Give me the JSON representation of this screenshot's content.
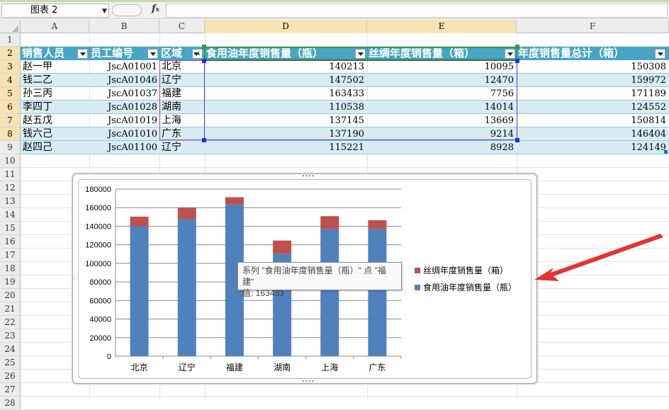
{
  "formula_bar": {
    "name_box": "图表 2",
    "formula": ""
  },
  "columns": [
    "A",
    "B",
    "C",
    "D",
    "E",
    "F"
  ],
  "rows": [
    "1",
    "2",
    "3",
    "4",
    "5",
    "6",
    "7",
    "8",
    "9",
    "10",
    "11",
    "12",
    "13",
    "14",
    "15",
    "16",
    "17",
    "18",
    "19",
    "20",
    "21",
    "22",
    "23",
    "24",
    "25",
    "26",
    "27",
    "28"
  ],
  "table": {
    "headers": [
      "销售人员",
      "员工编号",
      "区域",
      "食用油年度销售量（瓶）",
      "丝绸年度销售量（箱）",
      "年度销售量总计（箱）"
    ],
    "data_rows": [
      {
        "name": "赵一甲",
        "id": "JscA01001",
        "region": "北京",
        "oil": "140213",
        "silk": "10095",
        "total": "150308"
      },
      {
        "name": "钱二乙",
        "id": "JscA01046",
        "region": "辽宁",
        "oil": "147502",
        "silk": "12470",
        "total": "159972"
      },
      {
        "name": "孙三丙",
        "id": "JscA01037",
        "region": "福建",
        "oil": "163433",
        "silk": "7756",
        "total": "171189"
      },
      {
        "name": "李四丁",
        "id": "JscA01028",
        "region": "湖南",
        "oil": "110538",
        "silk": "14014",
        "total": "124552"
      },
      {
        "name": "赵五戊",
        "id": "JscA01019",
        "region": "上海",
        "oil": "137145",
        "silk": "13669",
        "total": "150814"
      },
      {
        "name": "钱六己",
        "id": "JscA01010",
        "region": "广东",
        "oil": "137190",
        "silk": "9214",
        "total": "146404"
      },
      {
        "name": "赵四己",
        "id": "JscA01100",
        "region": "辽宁",
        "oil": "115221",
        "silk": "8928",
        "total": "124149"
      }
    ]
  },
  "colors": {
    "header_fill": "#48a5c5",
    "band_fill": "#d8ecf3",
    "series_oil": "#4f81bd",
    "series_silk": "#c0504d",
    "arrow": "#e53333"
  },
  "chart_data": {
    "type": "bar",
    "stacked": true,
    "categories": [
      "北京",
      "辽宁",
      "福建",
      "湖南",
      "上海",
      "广东"
    ],
    "series": [
      {
        "name": "食用油年度销售量（瓶）",
        "values": [
          140213,
          147502,
          163433,
          110538,
          137145,
          137190
        ]
      },
      {
        "name": "丝绸年度销售量（箱）",
        "values": [
          10095,
          12470,
          7756,
          14014,
          13669,
          9214
        ]
      }
    ],
    "ylim": [
      0,
      180000
    ],
    "yticks": [
      "0",
      "20000",
      "40000",
      "60000",
      "80000",
      "100000",
      "120000",
      "140000",
      "160000",
      "180000"
    ],
    "grid": true,
    "legend_position": "right",
    "legend": [
      "丝绸年度销售量（箱）",
      "食用油年度销售量（瓶）"
    ]
  },
  "tooltip": {
    "line1": "系列 \"食用油年度销售量（瓶）\" 点 \"福建\"",
    "line2": "值: 163433"
  }
}
